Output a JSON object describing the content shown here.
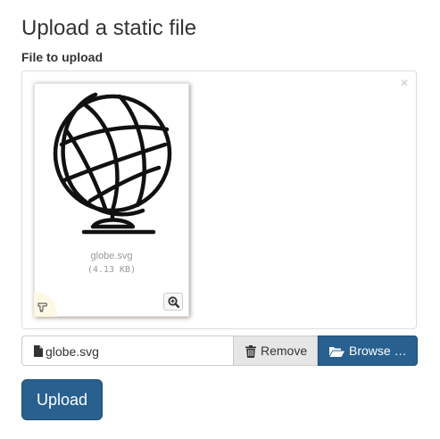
{
  "page": {
    "title": "Upload a static file"
  },
  "form": {
    "field_label": "File to upload"
  },
  "preview": {
    "close_symbol": "×",
    "file_name": "globe.svg",
    "file_size": "(4.13 KB)",
    "image_icon": "globe-icon",
    "handle_icon": "hand-pointer-icon",
    "zoom_icon": "zoom-in-icon"
  },
  "file_input": {
    "caption": "globe.svg",
    "caption_icon": "file-icon",
    "remove_label": "Remove",
    "remove_icon": "trash-icon",
    "browse_label": "Browse …",
    "browse_icon": "folder-open-icon"
  },
  "actions": {
    "upload_label": "Upload"
  },
  "colors": {
    "primary": "#286090",
    "primary_border": "#204d74",
    "remove_bg": "#e6e6e6",
    "handle_bg": "#fcf8e3"
  }
}
